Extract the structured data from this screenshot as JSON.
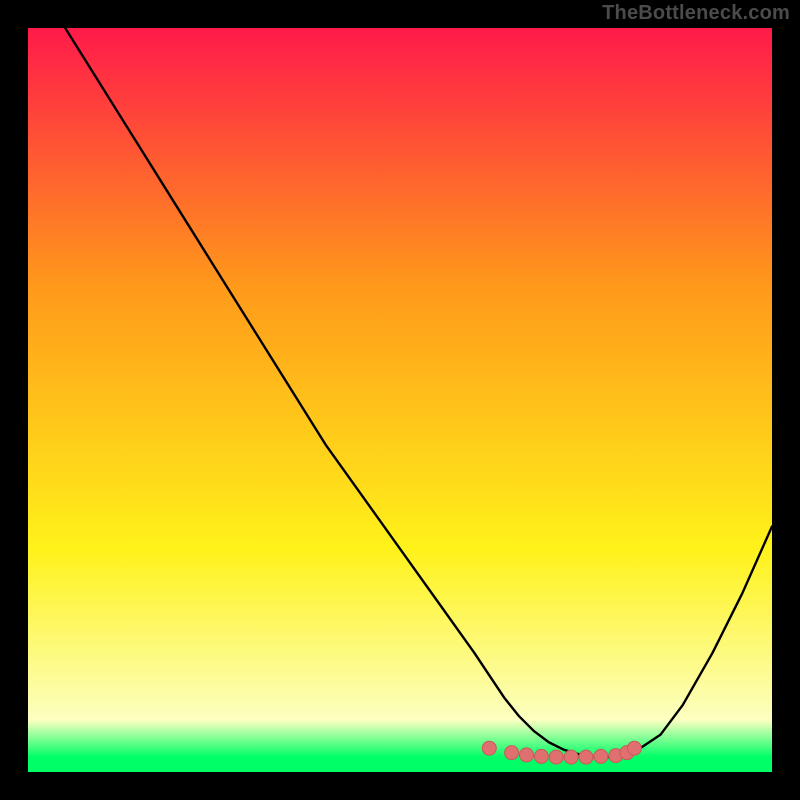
{
  "watermark": "TheBottleneck.com",
  "colors": {
    "frame": "#000000",
    "curve": "#000000",
    "dot": "#e07070",
    "dot_stroke": "#c85a5a",
    "gradient_top": "#ff1a4a",
    "gradient_mid_upper": "#ff9a1a",
    "gradient_mid_lower": "#fff21a",
    "gradient_pale": "#fcffc0",
    "gradient_green": "#00ff66"
  },
  "chart_data": {
    "type": "line",
    "title": "",
    "xlabel": "",
    "ylabel": "",
    "xlim": [
      0,
      100
    ],
    "ylim": [
      0,
      100
    ],
    "series": [
      {
        "name": "bottleneck-curve",
        "x": [
          5,
          10,
          15,
          20,
          25,
          30,
          35,
          40,
          45,
          50,
          55,
          60,
          62,
          64,
          66,
          68,
          70,
          72,
          74,
          76,
          78,
          80,
          82,
          85,
          88,
          92,
          96,
          100
        ],
        "y": [
          100,
          92,
          84,
          76,
          68,
          60,
          52,
          44,
          37,
          30,
          23,
          16,
          13,
          10,
          7.5,
          5.5,
          4,
          3,
          2.4,
          2.0,
          2.0,
          2.2,
          3.0,
          5,
          9,
          16,
          24,
          33
        ]
      }
    ],
    "optimal_markers": {
      "name": "optimal-range-dots",
      "x": [
        62,
        65,
        67,
        69,
        71,
        73,
        75,
        77,
        79,
        80.5,
        81.5
      ],
      "y": [
        3.2,
        2.6,
        2.3,
        2.1,
        2.0,
        2.0,
        2.0,
        2.1,
        2.2,
        2.6,
        3.2
      ]
    }
  }
}
